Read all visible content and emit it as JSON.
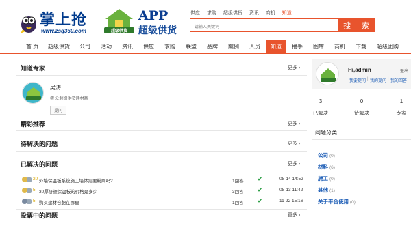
{
  "logo": {
    "main": "掌上抢",
    "url": "www.zsq360.com",
    "app": "APP",
    "app_cn": "超级供货",
    "badge": "超级供货"
  },
  "toplinks": [
    {
      "label": "供应",
      "active": false
    },
    {
      "label": "求购",
      "active": false
    },
    {
      "label": "超级供货",
      "active": false
    },
    {
      "label": "资讯",
      "active": false
    },
    {
      "label": "商机",
      "active": false
    },
    {
      "label": "知道",
      "active": true
    }
  ],
  "search": {
    "placeholder": "请输入关键词",
    "button": "搜 索"
  },
  "nav": [
    "首 页",
    "超级供货",
    "公司",
    "活动",
    "资讯",
    "供应",
    "求购",
    "联盟",
    "品牌",
    "案例",
    "人员",
    "知道",
    "播手",
    "图库",
    "商机",
    "下载",
    "超级团购"
  ],
  "nav_active": "知道",
  "experts": {
    "title": "知道专家",
    "more": "更多 ›",
    "name": "吴涛",
    "desc": "擅长:超级供货建材商",
    "ask": "提问"
  },
  "featured": {
    "title": "精彩推荐",
    "more": "更多 ›"
  },
  "pending": {
    "title": "待解决的问题",
    "more": "更多 ›"
  },
  "solved": {
    "title": "已解决的问题",
    "more": "更多 ›",
    "rows": [
      {
        "points": "20",
        "question": "外墙保温板系统施工墙体需要粉刷吗?",
        "answers": "1回答",
        "date": "08-14 14:52"
      },
      {
        "points": "5",
        "question": "30厚挤塑保温板的价格是多少",
        "answers": "3回答",
        "date": "08-13 11:42"
      },
      {
        "points": "5",
        "question": "购买建材合肥在哪里",
        "answers": "1回答",
        "date": "11-22 15:16"
      }
    ]
  },
  "voting": {
    "title": "投票中的问题",
    "more": "更多 ›"
  },
  "user": {
    "greeting": "Hi,admin",
    "logout": "退出",
    "links": [
      "我要提问",
      "我的提问",
      "我的回答"
    ],
    "stats": [
      {
        "value": "3",
        "label": "已解决"
      },
      {
        "value": "0",
        "label": "待解决"
      },
      {
        "value": "1",
        "label": "专家"
      }
    ]
  },
  "categories": {
    "title": "问题分类",
    "items": [
      {
        "name": "公司",
        "count": "(0)"
      },
      {
        "name": "材料",
        "count": "(6)"
      },
      {
        "name": "施工",
        "count": "(0)"
      },
      {
        "name": "其他",
        "count": "(1)"
      },
      {
        "name": "关于平台使用",
        "count": "(0)"
      }
    ]
  },
  "colors": {
    "accent": "#e8542d",
    "link": "#1a5bb5",
    "check": "#2a9d43"
  }
}
